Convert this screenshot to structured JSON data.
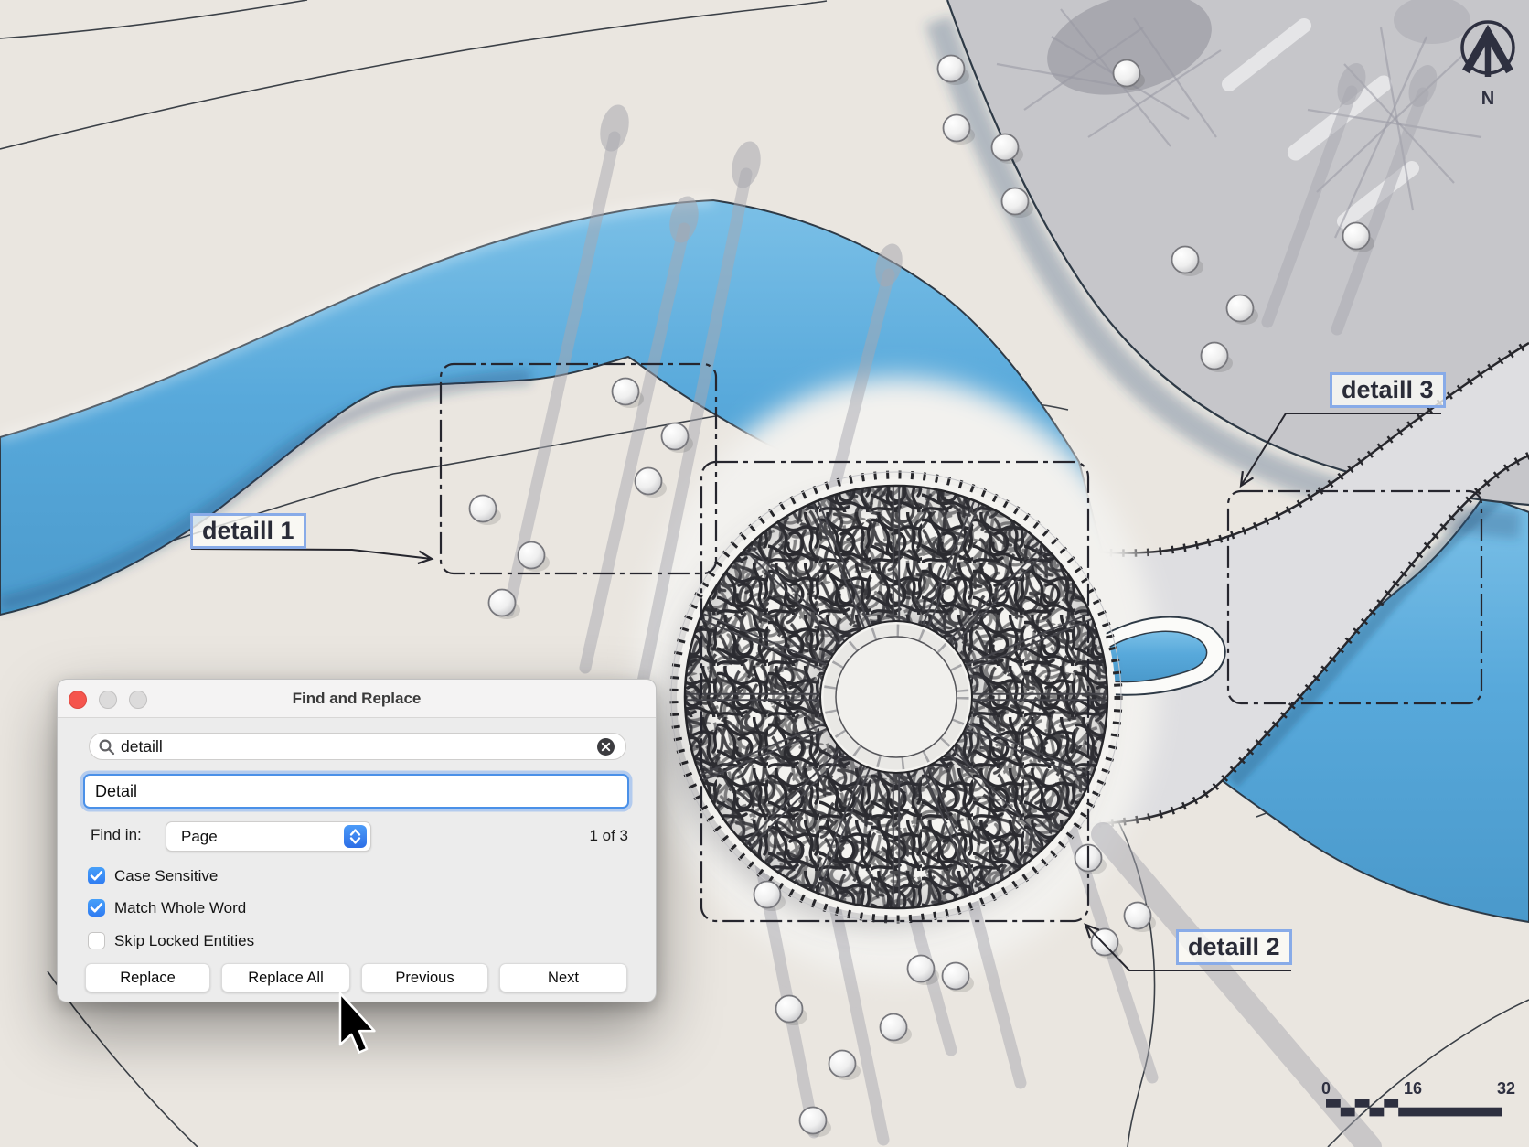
{
  "window": {
    "title": "Find and Replace",
    "search_value": "detaill",
    "replace_value": "Detail",
    "find_in_label": "Find in:",
    "scope_value": "Page",
    "match_counter": "1 of 3",
    "options": [
      {
        "label": "Case Sensitive",
        "checked": true
      },
      {
        "label": "Match Whole Word",
        "checked": true
      },
      {
        "label": "Skip Locked Entities",
        "checked": false
      }
    ],
    "buttons": {
      "replace": "Replace",
      "replace_all": "Replace All",
      "previous": "Previous",
      "next": "Next"
    }
  },
  "canvas": {
    "detail_labels": {
      "detail1": "detaill 1",
      "detail2": "detaill 2",
      "detail3": "detaill 3"
    },
    "north_label": "N",
    "scale_bar": {
      "ticks": [
        "0",
        "16",
        "32"
      ]
    },
    "colors": {
      "paper": "#eae6e0",
      "river": "#58a9db",
      "plaza": "#c6c6ca",
      "ink": "#30343c",
      "label_border": "#88abe8"
    }
  }
}
